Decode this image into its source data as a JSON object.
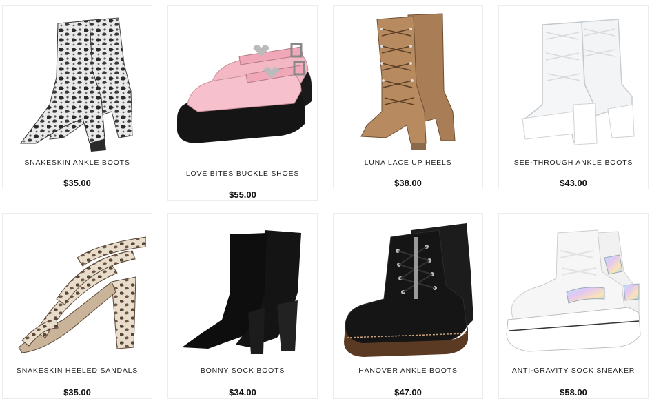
{
  "products": [
    {
      "name": "SNAKESKIN ANKLE BOOTS",
      "price": "$35.00",
      "image": "snakeskin-ankle-boot"
    },
    {
      "name": "LOVE BITES BUCKLE SHOES",
      "price": "$55.00",
      "image": "pink-buckle-platform-shoe"
    },
    {
      "name": "LUNA LACE UP HEELS",
      "price": "$38.00",
      "image": "tan-lace-up-heel"
    },
    {
      "name": "SEE-THROUGH ANKLE BOOTS",
      "price": "$43.00",
      "image": "clear-platform-boot"
    },
    {
      "name": "SNAKESKIN HEELED SANDALS",
      "price": "$35.00",
      "image": "snakeskin-strappy-sandal"
    },
    {
      "name": "BONNY SOCK BOOTS",
      "price": "$34.00",
      "image": "black-sock-boot"
    },
    {
      "name": "HANOVER ANKLE BOOTS",
      "price": "$47.00",
      "image": "black-combat-boot"
    },
    {
      "name": "ANTI-GRAVITY SOCK SNEAKER",
      "price": "$58.00",
      "image": "white-sock-sneaker"
    }
  ]
}
